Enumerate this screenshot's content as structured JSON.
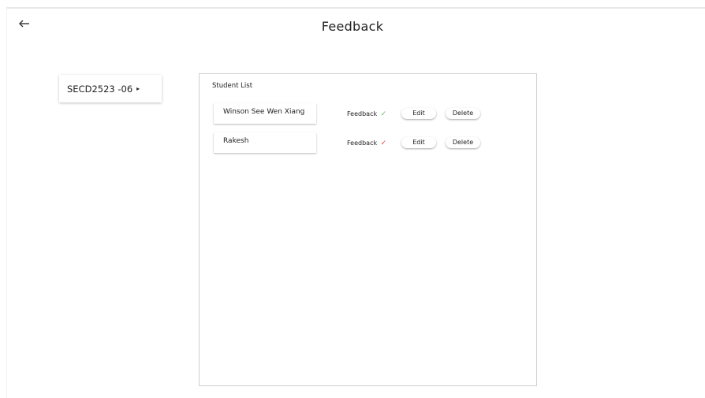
{
  "header": {
    "title": "Feedback",
    "back_icon": "arrow-left-icon"
  },
  "sidebar": {
    "course": {
      "label": "SECD2523 -06",
      "caret": "▸"
    }
  },
  "student_list": {
    "title": "Student List",
    "rows": [
      {
        "name": "Winson See Wen Xiang",
        "feedback_label": "Feedback",
        "feedback_status": "✓",
        "feedback_status_color": "#5cc25c",
        "edit_label": "Edit",
        "delete_label": "Delete"
      },
      {
        "name": "Rakesh",
        "feedback_label": "Feedback",
        "feedback_status": "✓",
        "feedback_status_color": "#e24848",
        "edit_label": "Edit",
        "delete_label": "Delete"
      }
    ]
  }
}
